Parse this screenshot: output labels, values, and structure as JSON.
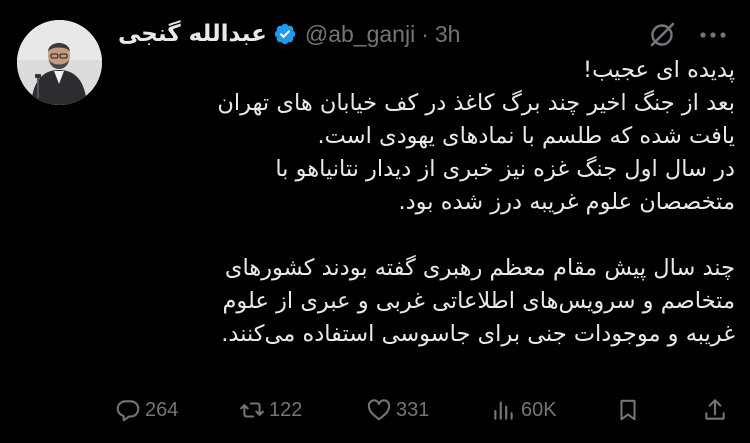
{
  "author": {
    "display_name": "عبدالله گنجی",
    "handle": "@ab_ganji",
    "separator": "·",
    "time": "3h",
    "verified": true
  },
  "icons": {
    "avatar": "profile-photo-man-at-podium",
    "verified": "verified-badge-icon",
    "grok": "grok-icon",
    "more": "more-dots-icon"
  },
  "tweet": {
    "lines": [
      "پدیده ای عجیب!",
      "بعد از جنگ اخیر چند برگ کاغذ در کف خیابان های تهران",
      "یافت شده که طلسم با نمادهای یهودی است.",
      "در سال اول جنگ غزه نیز خبری از دیدار نتانیاهو با",
      "متخصصان علوم غریبه درز شده بود.",
      "",
      "چند سال پیش مقام معظم رهبری گفته بودند کشورهای",
      "متخاصم و سرویس‌های اطلاعاتی غربی و عبری از علوم",
      "غریبه و موجودات جنی برای جاسوسی استفاده می‌کنند."
    ]
  },
  "actions": {
    "replies": "264",
    "retweets": "122",
    "likes": "331",
    "views": "60K"
  },
  "colors": {
    "background": "#000000",
    "text": "#e7e9ea",
    "muted": "#71767b",
    "verified": "#1d9bf0"
  }
}
